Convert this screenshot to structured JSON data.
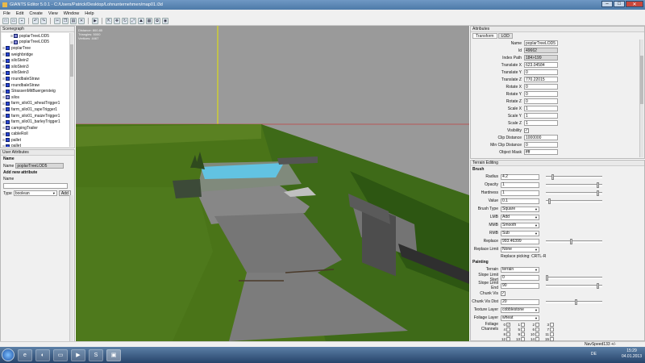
{
  "app": {
    "title": "GIANTS Editor 5.0.1 - C:/Users/Patrick/Desktop/Lohnunternehmen/map01.i3d"
  },
  "menu": [
    "File",
    "Edit",
    "Create",
    "View",
    "Window",
    "Help"
  ],
  "scenegraph": {
    "title": "Scenegraph",
    "items": [
      {
        "label": "poplarTreeLOD5",
        "indent": 2,
        "type": "transform"
      },
      {
        "label": "poplarTreeLOD5",
        "indent": 2,
        "type": "transform"
      },
      {
        "label": "poplarTree",
        "indent": 0,
        "type": "shape"
      },
      {
        "label": "weighbridge",
        "indent": 0,
        "type": "shape"
      },
      {
        "label": "siloStein2",
        "indent": 0,
        "type": "shape"
      },
      {
        "label": "siloStein3",
        "indent": 0,
        "type": "shape"
      },
      {
        "label": "siloStein3",
        "indent": 0,
        "type": "shape"
      },
      {
        "label": "roundbaleStraw",
        "indent": 0,
        "type": "shape"
      },
      {
        "label": "roundbaleStraw",
        "indent": 0,
        "type": "shape"
      },
      {
        "label": "StrassenMitBuergersteig",
        "indent": 0,
        "type": "shape"
      },
      {
        "label": "silos",
        "indent": 0,
        "type": "transform"
      },
      {
        "label": "farm_silo01_wheatTrigger1",
        "indent": 0,
        "type": "shape"
      },
      {
        "label": "farm_silo01_rapeTrigger1",
        "indent": 0,
        "type": "shape"
      },
      {
        "label": "farm_silo01_maizeTrigger1",
        "indent": 0,
        "type": "shape"
      },
      {
        "label": "farm_silo01_barleyTrigger1",
        "indent": 0,
        "type": "shape"
      },
      {
        "label": "campingTrailer",
        "indent": 0,
        "type": "transform"
      },
      {
        "label": "cableRoll",
        "indent": 0,
        "type": "shape"
      },
      {
        "label": "pallet",
        "indent": 0,
        "type": "shape"
      },
      {
        "label": "pallet",
        "indent": 0,
        "type": "shape"
      }
    ]
  },
  "user_attributes": {
    "title": "User Attributes",
    "name_heading": "Name",
    "name_label": "Name",
    "name_value": "poplarTreeLOD5",
    "add_heading": "Add new attribute",
    "new_name_label": "Name",
    "type_label": "Type",
    "type_value": "boolean",
    "add_button": "Add"
  },
  "viewport": {
    "stats": [
      "Distance: 800.85",
      "Triangles: 5000",
      "Vertices: 4467"
    ]
  },
  "attributes": {
    "title": "Attributes",
    "tabs": [
      "Transform",
      "LOD"
    ],
    "rows": [
      {
        "label": "Name",
        "value": "poplarTreeLOD5",
        "style": "white"
      },
      {
        "label": "Id",
        "value": "49662",
        "style": "grey"
      },
      {
        "label": "Index Path",
        "value": "184>199",
        "style": "grey"
      },
      {
        "label": "Translate X",
        "value": "623.04584",
        "style": "white"
      },
      {
        "label": "Translate Y",
        "value": "0",
        "style": "white"
      },
      {
        "label": "Translate Z",
        "value": "770.22015",
        "style": "white"
      },
      {
        "label": "Rotate X",
        "value": "0",
        "style": "white"
      },
      {
        "label": "Rotate Y",
        "value": "0",
        "style": "white"
      },
      {
        "label": "Rotate Z",
        "value": "0",
        "style": "white"
      },
      {
        "label": "Scale X",
        "value": "1",
        "style": "white"
      },
      {
        "label": "Scale Y",
        "value": "1",
        "style": "white"
      },
      {
        "label": "Scale Z",
        "value": "1",
        "style": "white"
      },
      {
        "label": "Visibility",
        "value": "✓",
        "style": "check"
      },
      {
        "label": "Clip Distance",
        "value": "1000000",
        "style": "white"
      },
      {
        "label": "Min Clip Distance",
        "value": "0",
        "style": "white"
      },
      {
        "label": "Object Mask",
        "value": "ffff",
        "style": "white"
      }
    ]
  },
  "terrain": {
    "title": "Terrain Editing",
    "brush_heading": "Brush",
    "brush": [
      {
        "label": "Radius",
        "value": "4.2",
        "slider": 0.1
      },
      {
        "label": "Opacity",
        "value": "1",
        "slider": 0.95
      },
      {
        "label": "Hardness",
        "value": "1",
        "slider": 0.95
      },
      {
        "label": "Value",
        "value": "0.1",
        "slider": 0.05
      }
    ],
    "brush_type_label": "Brush Type",
    "brush_type": "Square",
    "lmb_label": "LMB",
    "lmb": "Add",
    "mmb_label": "MMB",
    "mmb": "Smooth",
    "rmb_label": "RMB",
    "rmb": "Sub",
    "replace_label": "Replace",
    "replace": "993.46399",
    "replace_slider": 0.45,
    "replace_limit_label": "Replace Limit",
    "replace_limit": "None",
    "replace_hint": "Replace picking: CRTL-R",
    "painting_heading": "Painting",
    "terrain_label": "Terrain",
    "terrain_value": "terrain",
    "slope_start_label": "Slope Limit Start",
    "slope_start": "0",
    "slope_start_slider": 0.0,
    "slope_end_label": "Slope Limit End",
    "slope_end": "90",
    "slope_end_slider": 0.95,
    "chunk_vis_label": "Chunk Vis",
    "chunk_vis": "✓",
    "chunk_vis_dist_label": "Chunk Vis Dist",
    "chunk_vis_dist": "20",
    "chunk_vis_dist_slider": 0.55,
    "texture_layer_label": "Texture Layer",
    "texture_layer": "cobblestone",
    "foliage_layer_label": "Foliage Layer",
    "foliage_layer": "wheat",
    "foliage_channels_label": "Foliage Channels",
    "channels": [
      "0",
      "1",
      "2",
      "3",
      "4",
      "5",
      "6",
      "7",
      "8",
      "9",
      "10",
      "11",
      "12",
      "13",
      "14",
      "15"
    ],
    "channels_checked": [
      0
    ]
  },
  "status": {
    "navspeed": "NavSpeed133 +/-"
  },
  "taskbar": {
    "language": "DE",
    "time": "15:29",
    "date": "04.01.2013"
  }
}
